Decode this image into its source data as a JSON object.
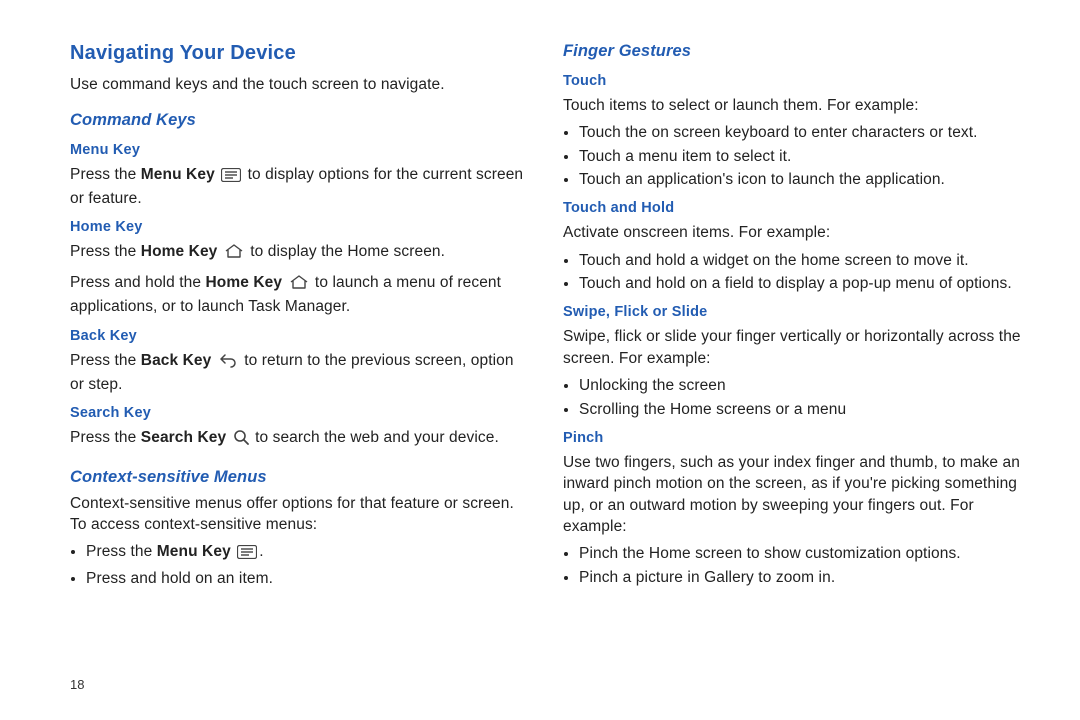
{
  "pageNumber": "18",
  "left": {
    "title": "Navigating Your Device",
    "intro": "Use command keys and the touch screen to navigate.",
    "commandKeysHeading": "Command Keys",
    "menuKey": {
      "heading": "Menu Key",
      "t1": "Press the ",
      "bold": "Menu Key",
      "t2": " to display options for the current screen or feature."
    },
    "homeKey": {
      "heading": "Home Key",
      "p1_t1": "Press the ",
      "p1_bold": "Home Key",
      "p1_t2": " to display the Home screen.",
      "p2_t1": "Press and hold the ",
      "p2_bold": "Home Key",
      "p2_t2": " to launch a menu of recent applications, or to launch Task Manager."
    },
    "backKey": {
      "heading": "Back Key",
      "t1": "Press the ",
      "bold": "Back Key",
      "t2": " to return to the previous screen, option or step."
    },
    "searchKey": {
      "heading": "Search Key",
      "t1": "Press the ",
      "bold": "Search Key",
      "t2": " to search the web and your device."
    },
    "contextHeading": "Context-sensitive Menus",
    "contextText": "Context-sensitive menus offer options for that feature or screen. To access context-sensitive menus:",
    "contextBullet1_t1": "Press the ",
    "contextBullet1_bold": "Menu Key",
    "contextBullet1_t2": ".",
    "contextBullet2": "Press and hold on an item."
  },
  "right": {
    "fingerHeading": "Finger Gestures",
    "touch": {
      "heading": "Touch",
      "text": "Touch items to select or launch them. For example:",
      "b1": "Touch the on screen keyboard to enter characters or text.",
      "b2": "Touch a menu item to select it.",
      "b3": "Touch an application's icon to launch the application."
    },
    "touchHold": {
      "heading": "Touch and Hold",
      "text": "Activate onscreen items. For example:",
      "b1": "Touch and hold a widget on the home screen to move it.",
      "b2": "Touch and hold on a field to display a pop-up menu of options."
    },
    "swipe": {
      "heading": "Swipe, Flick or Slide",
      "text": "Swipe, flick or slide your finger vertically or horizontally across the screen. For example:",
      "b1": "Unlocking the screen",
      "b2": "Scrolling the Home screens or a menu"
    },
    "pinch": {
      "heading": "Pinch",
      "text": "Use two fingers, such as your index finger and thumb, to make an inward pinch motion on the screen, as if you're picking something up, or an outward motion by sweeping your fingers out. For example:",
      "b1": "Pinch the Home screen to show customization options.",
      "b2": "Pinch a picture in Gallery to zoom in."
    }
  }
}
